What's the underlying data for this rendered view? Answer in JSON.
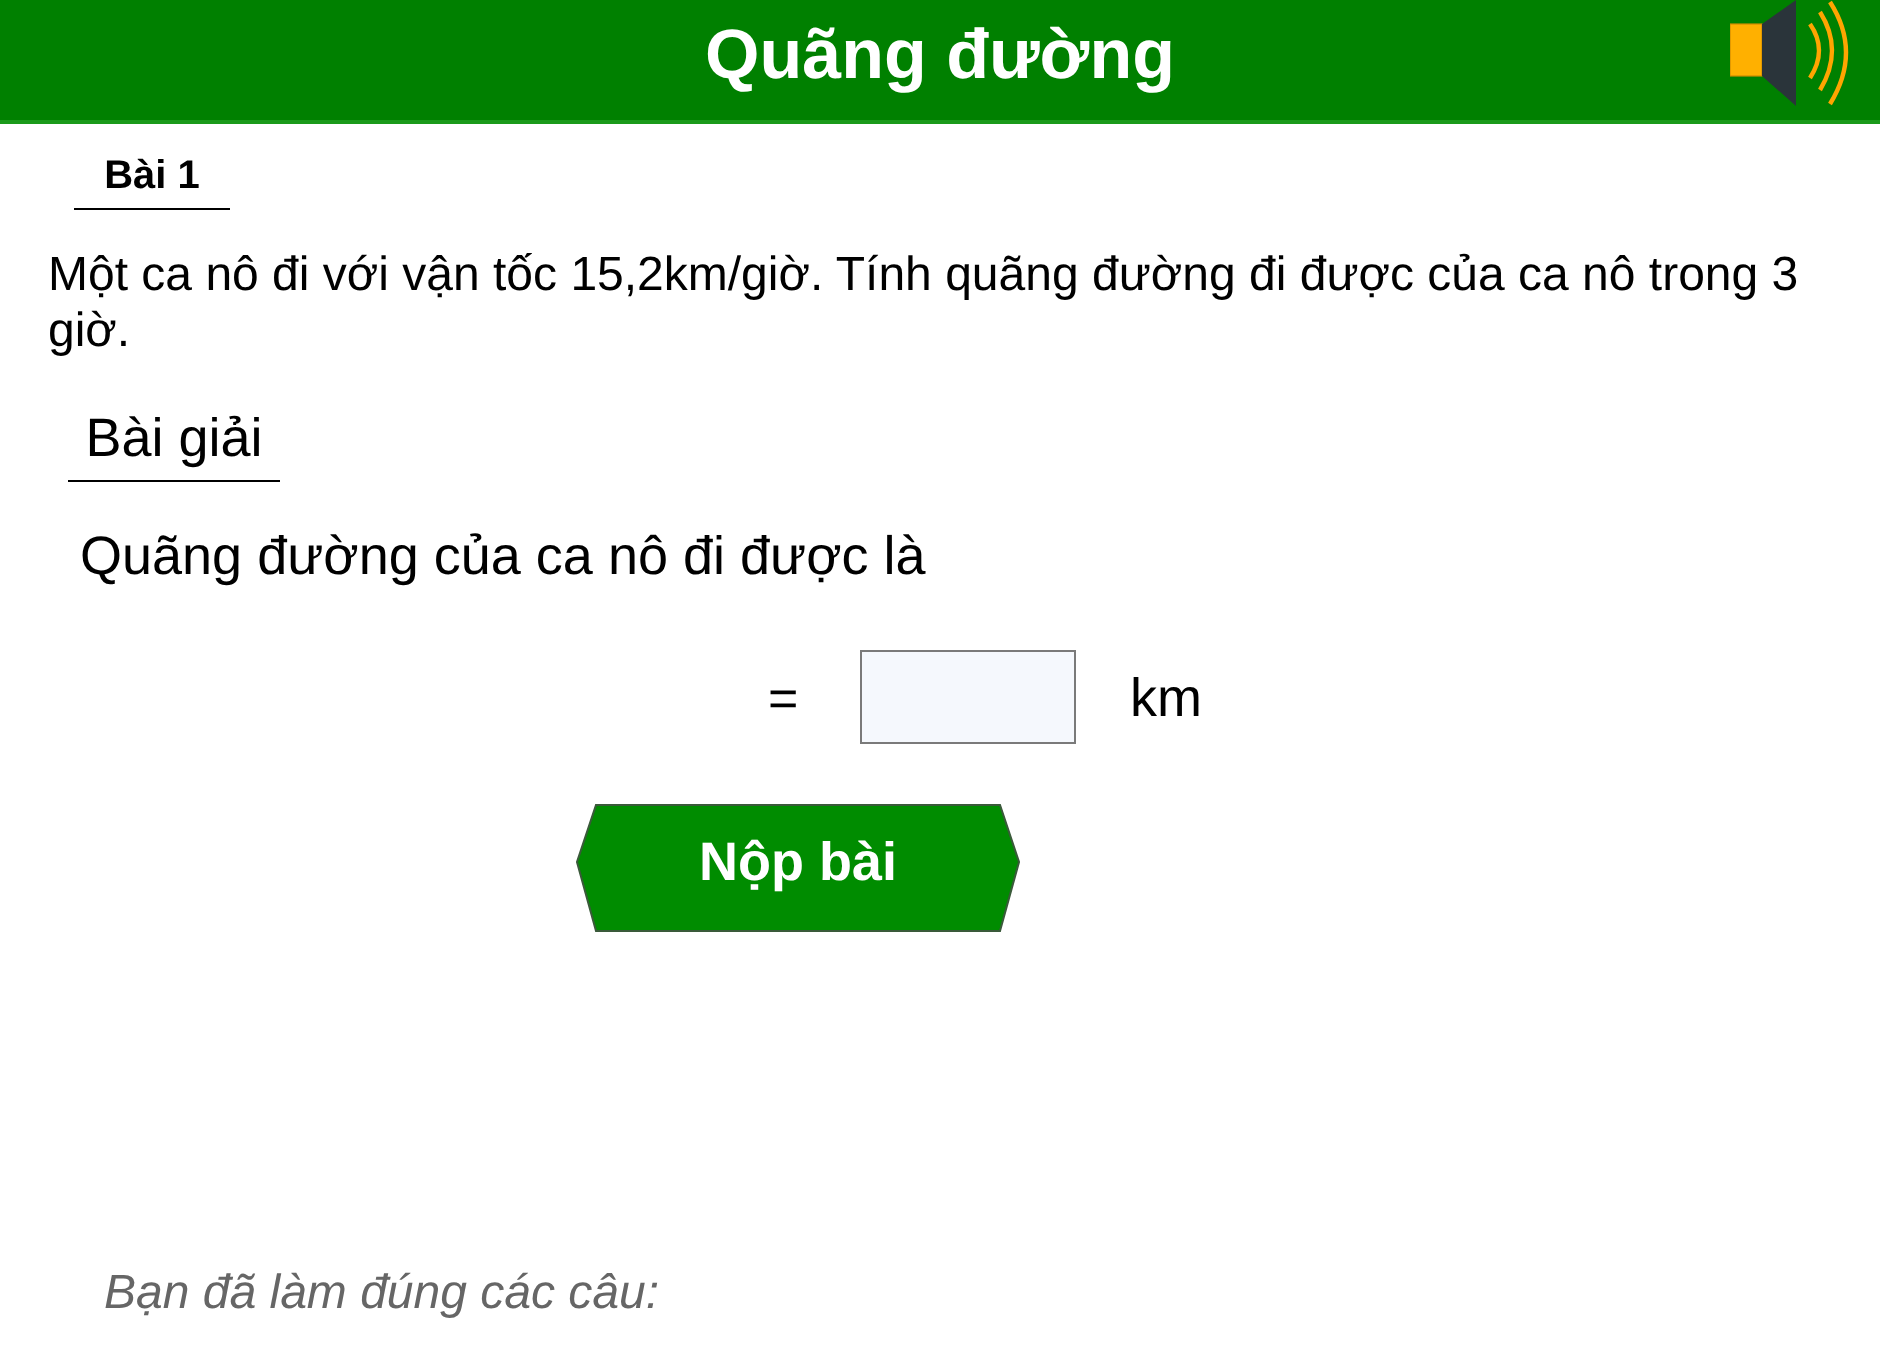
{
  "header": {
    "title": "Quãng đường"
  },
  "exercise": {
    "label": "Bài 1",
    "problem": "Một ca nô đi với vận tốc 15,2km/giờ. Tính quãng đường đi được của ca nô trong 3 giờ."
  },
  "solution": {
    "heading": "Bài giải",
    "statement": "Quãng đường của ca nô đi được là",
    "sign": "=",
    "unit": "km"
  },
  "submit_button": {
    "label": "Nộp bài"
  },
  "result": {
    "text": "Bạn đã làm đúng các câu:"
  }
}
